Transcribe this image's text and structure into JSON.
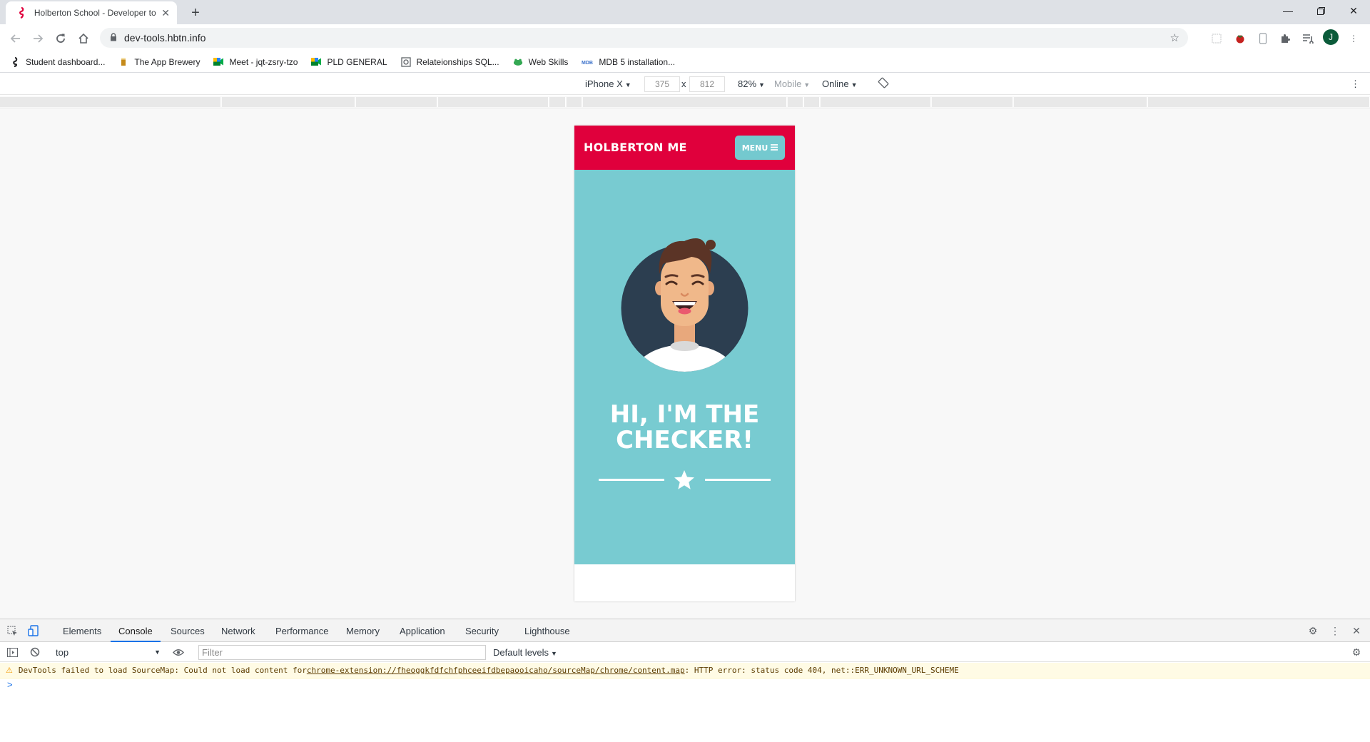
{
  "browser": {
    "tab_title": "Holberton School - Developer to",
    "url": "dev-tools.hbtn.info",
    "profile_initial": "J"
  },
  "bookmarks": [
    {
      "label": "Student dashboard...",
      "icon": "seahorse-icon"
    },
    {
      "label": "The App Brewery",
      "icon": "brewery-icon"
    },
    {
      "label": "Meet - jqt-zsry-tzo",
      "icon": "meet-icon"
    },
    {
      "label": "PLD GENERAL",
      "icon": "meet-icon"
    },
    {
      "label": "Relateionships SQL...",
      "icon": "sql-icon"
    },
    {
      "label": "Web Skills",
      "icon": "frog-icon"
    },
    {
      "label": "MDB 5 installation...",
      "icon": "mdb-icon"
    }
  ],
  "device_toolbar": {
    "device": "iPhone X",
    "width": "375",
    "times": "x",
    "height": "812",
    "zoom": "82%",
    "mode": "Mobile",
    "network": "Online"
  },
  "phone_page": {
    "brand": "HOLBERTON ME",
    "menu_label": "MENU",
    "headline_line1": "HI, I'M THE",
    "headline_line2": "CHECKER!",
    "colors": {
      "header": "#e0003c",
      "hero": "#78cbd1",
      "menu": "#74c9cf"
    }
  },
  "devtools": {
    "tabs": [
      "Elements",
      "Console",
      "Sources",
      "Network",
      "Performance",
      "Memory",
      "Application",
      "Security",
      "Lighthouse"
    ],
    "active_tab": "Console",
    "context": "top",
    "filter_placeholder": "Filter",
    "levels": "Default levels",
    "warning": {
      "prefix": "DevTools failed to load SourceMap: Could not load content for ",
      "link": "chrome-extension://fheoggkfdfchfphceeifdbepaooicaho/sourceMap/chrome/content.map",
      "suffix": ": HTTP error: status code 404, net::ERR_UNKNOWN_URL_SCHEME"
    },
    "prompt": ">"
  }
}
